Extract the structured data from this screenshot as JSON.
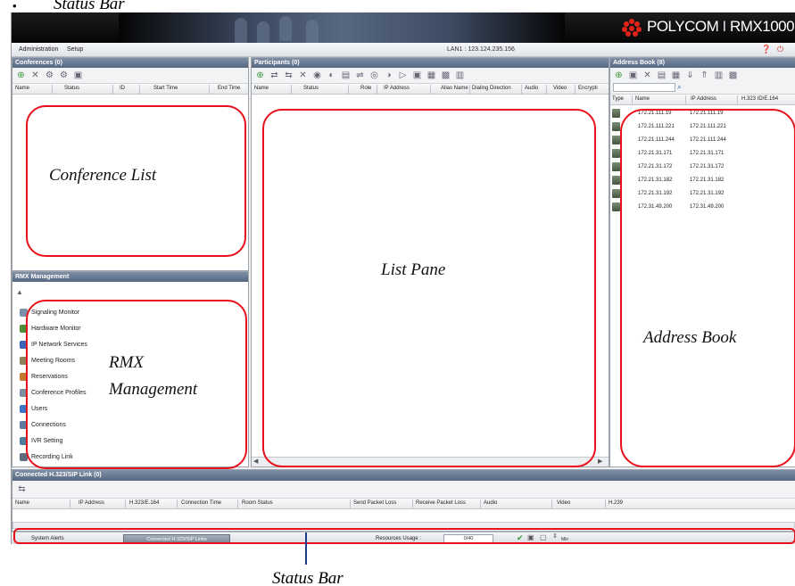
{
  "top_caption": "Status Bar",
  "bullet_glyph": "•",
  "app": {
    "brand_name": "POLYCOM",
    "brand_separator": "I",
    "product_name": "RMX1000",
    "lan_status": "LAN1 : 123.124.235.156",
    "menu": [
      "Administration",
      "Setup"
    ]
  },
  "conferences": {
    "title": "Conferences (0)",
    "columns": [
      "Name",
      "Status",
      "ID",
      "Start Time",
      "End Time"
    ]
  },
  "participants": {
    "title": "Participants (0)",
    "columns": [
      "Name",
      "Status",
      "Role",
      "IP Address",
      "Alias Name",
      "Dialing Direction",
      "Audio",
      "Video",
      "Encrypti"
    ]
  },
  "address_book": {
    "title": "Address Book (8)",
    "columns": [
      "Type",
      "Name",
      "IP Address",
      "H.323 ID/E.164"
    ],
    "entries": [
      {
        "name": "172.21.111.19",
        "ip": "172.21.111.19"
      },
      {
        "name": "172.21.111.221",
        "ip": "172.21.111.221"
      },
      {
        "name": "172.21.111.244",
        "ip": "172.21.111.244"
      },
      {
        "name": "172.21.31.171",
        "ip": "172.21.31.171"
      },
      {
        "name": "172.21.31.172",
        "ip": "172.21.31.172"
      },
      {
        "name": "172.21.31.182",
        "ip": "172.21.31.182"
      },
      {
        "name": "172.21.31.192",
        "ip": "172.21.31.192"
      },
      {
        "name": "172.31.49.200",
        "ip": "172.31.49.200"
      }
    ]
  },
  "rmx_management": {
    "title": "RMX Management",
    "items": [
      {
        "label": "Signaling Monitor",
        "icon": "signaling-monitor-icon",
        "color": "#7b8fa8"
      },
      {
        "label": "Hardware Monitor",
        "icon": "hardware-monitor-icon",
        "color": "#4f8f3a"
      },
      {
        "label": "IP Network Services",
        "icon": "ip-network-services-icon",
        "color": "#3b63b8"
      },
      {
        "label": "Meeting Rooms",
        "icon": "meeting-rooms-icon",
        "color": "#8f7f5a"
      },
      {
        "label": "Reservations",
        "icon": "reservations-icon",
        "color": "#c2782d"
      },
      {
        "label": "Conference Profiles",
        "icon": "conference-profiles-icon",
        "color": "#7f8e9f"
      },
      {
        "label": "Users",
        "icon": "users-icon",
        "color": "#3f73c6"
      },
      {
        "label": "Connections",
        "icon": "connections-icon",
        "color": "#5f7a9f"
      },
      {
        "label": "IVR Setting",
        "icon": "ivr-setting-icon",
        "color": "#4d7f9c"
      },
      {
        "label": "Recording Link",
        "icon": "recording-link-icon",
        "color": "#5e6b7a"
      }
    ]
  },
  "connected_links": {
    "title": "Connected H.323/SIP Link (0)",
    "columns": [
      "Name",
      "IP Address",
      "H.323/E.164",
      "Connection Time",
      "Room Status",
      "Send Packet Loss",
      "Receive Packet Loss",
      "Audio",
      "Video",
      "H.239"
    ]
  },
  "status_bar": {
    "alerts_label": "System Alerts",
    "alerts_button": "Connected H.323/SIP Links",
    "resources_label": "Resources Usage :",
    "resources_value": "0/40",
    "extra_label": "Min"
  },
  "annotations": {
    "conference_list": "Conference List",
    "list_pane": "List Pane",
    "address_book": "Address Book",
    "rmx_management_line1": "RMX",
    "rmx_management_line2": "Management",
    "status_bar": "Status Bar"
  },
  "colors": {
    "highlight_border": "#e8101a",
    "header_bg": "#050505",
    "pane_title_bg": "#566781",
    "brand_red": "#e2231a"
  }
}
